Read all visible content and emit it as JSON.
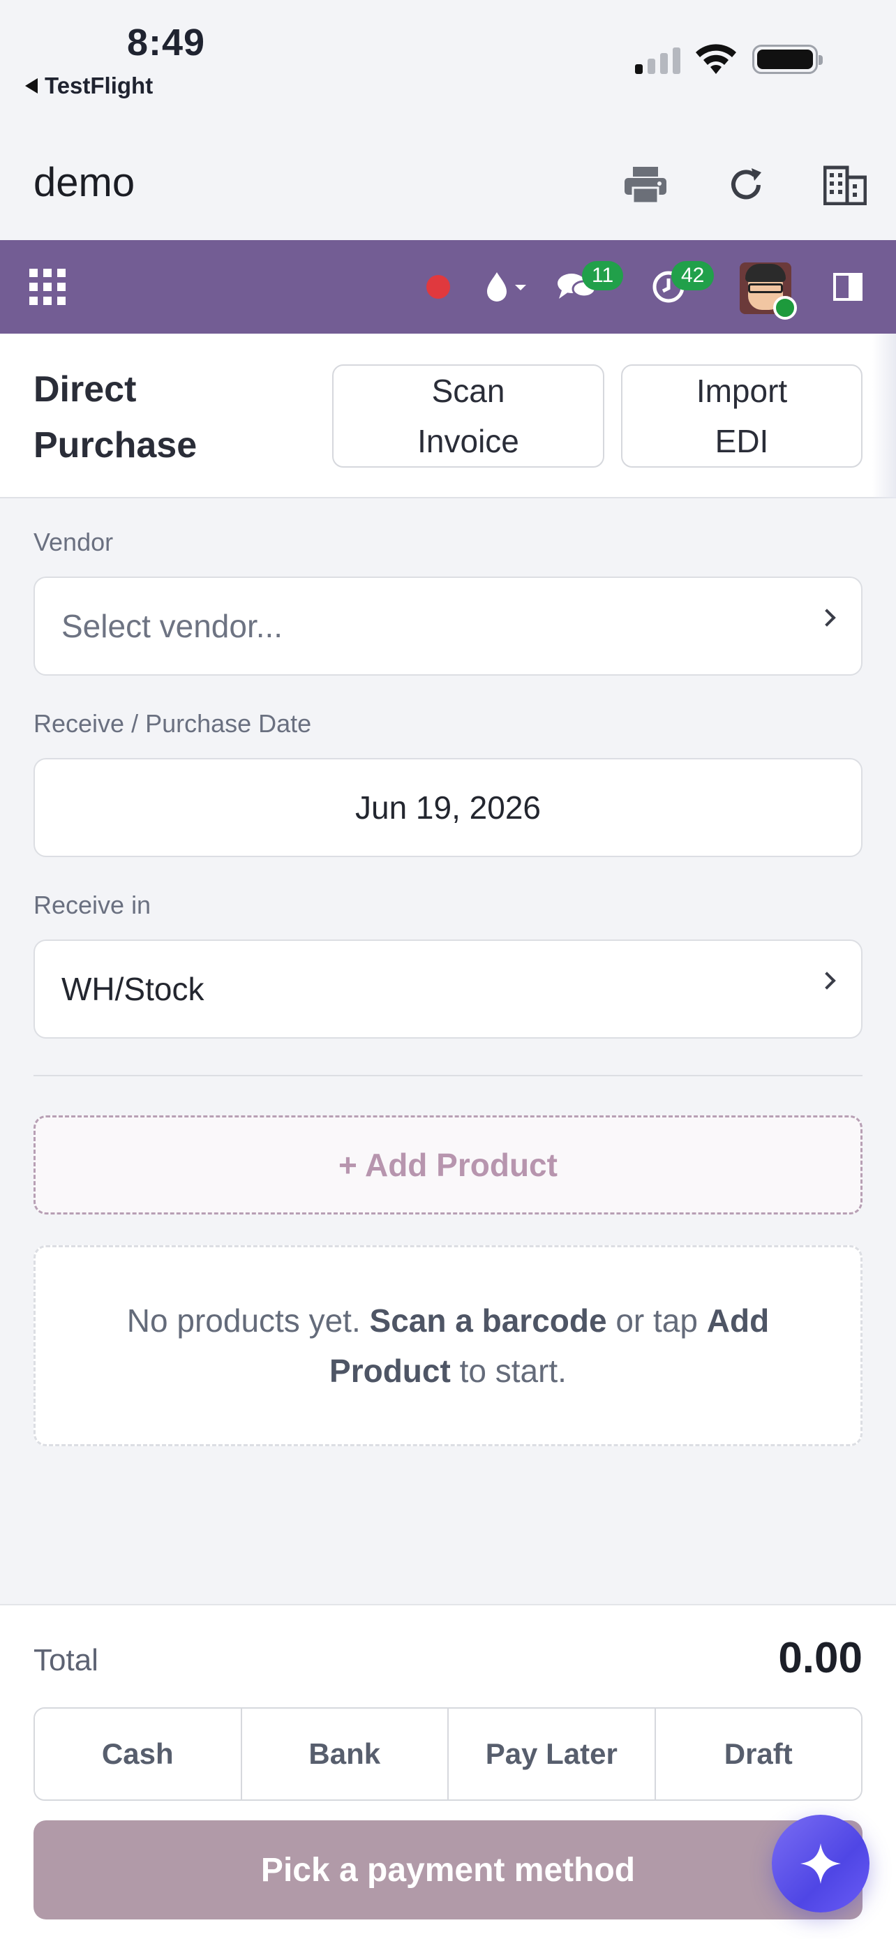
{
  "status_bar": {
    "time": "8:49",
    "back_app": "TestFlight"
  },
  "app_header": {
    "title": "demo",
    "icons": [
      "printer-icon",
      "refresh-icon",
      "building-icon"
    ]
  },
  "navbar": {
    "icons": [
      "apps-grid-icon",
      "recording-dot-icon",
      "theme-drop-icon",
      "chat-icon",
      "activity-clock-icon",
      "avatar",
      "panel-toggle-icon"
    ],
    "messages_badge": "11",
    "activities_badge": "42",
    "colors": {
      "navbar": "#735d94",
      "badge": "#21a04a",
      "record_dot": "#e0393e"
    }
  },
  "control_panel": {
    "title_line1": "Direct",
    "title_line2": "Purchase",
    "scan_line1": "Scan",
    "scan_line2": "Invoice",
    "import_line1": "Import",
    "import_line2": "EDI"
  },
  "form": {
    "vendor_label": "Vendor",
    "vendor_placeholder": "Select vendor...",
    "date_label": "Receive / Purchase Date",
    "date_value": "Jun 19, 2026",
    "location_label": "Receive in",
    "location_value": "WH/Stock"
  },
  "products": {
    "add_label": "+ Add Product",
    "empty_prefix": "No products yet. ",
    "empty_bold1": "Scan a barcode",
    "empty_mid": " or tap ",
    "empty_bold2": "Add Product",
    "empty_suffix": " to start."
  },
  "footer": {
    "total_label": "Total",
    "total_value": "0.00",
    "payment_options": [
      "Cash",
      "Bank",
      "Pay Later",
      "Draft"
    ],
    "pay_button": "Pick a payment method",
    "colors": {
      "pay_button": "#b19aa8",
      "fab": "#5b50ea"
    }
  }
}
